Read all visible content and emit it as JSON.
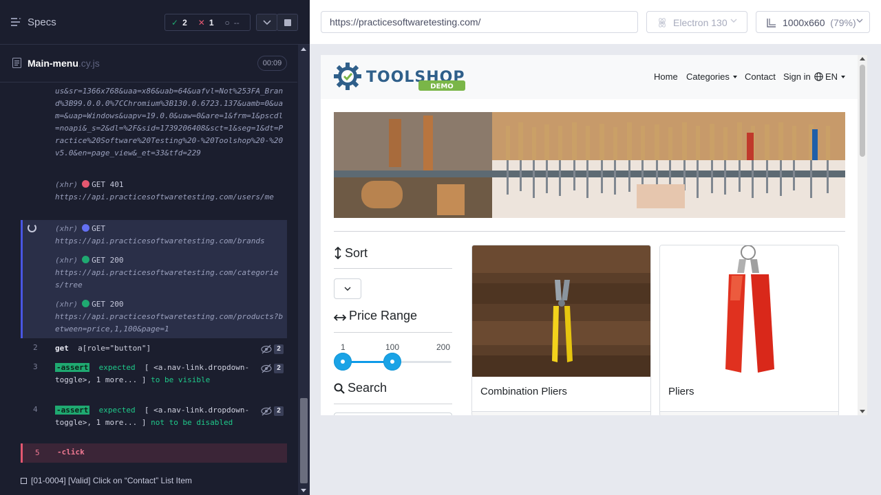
{
  "reporter": {
    "specs_label": "Specs",
    "stats": {
      "passed": "2",
      "failed": "1",
      "pending": "--"
    },
    "spec_name": "Main-menu",
    "spec_ext": ".cy.js",
    "duration": "00:09",
    "log": {
      "ga_url_tail": "us&sr=1366x768&uaa=x86&uab=64&uafvl=Not%253FA_Brand%3B99.0.0.0%7CChromium%3B130.0.6723.137&uamb=0&uam=&uap=Windows&uapv=19.0.0&uaw=0&are=1&frm=1&pscdl=noapi&_s=2&dl=%2F&sid=1739206408&sct=1&seg=1&dt=Practice%20Software%20Testing%20-%20Toolshop%20-%20v5.0&en=page_view&_et=33&tfd=229",
      "xhr_label": "(xhr)",
      "requests": [
        {
          "method": "GET 401",
          "url": "https://api.practicesoftwaretesting.com/users/me",
          "status_color": "red"
        },
        {
          "method": "GET",
          "url": "https://api.practicesoftwaretesting.com/brands",
          "status_color": "blue"
        },
        {
          "method": "GET 200",
          "url": "https://api.practicesoftwaretesting.com/categories/tree",
          "status_color": "green"
        },
        {
          "method": "GET 200",
          "url": "https://api.practicesoftwaretesting.com/products?between=price,1,100&page=1",
          "status_color": "green"
        }
      ],
      "commands": [
        {
          "num": "2",
          "name": "get",
          "arg": "a[role=\"button\"]",
          "count": "2"
        },
        {
          "num": "3",
          "name": "-assert",
          "text_a": "expected",
          "text_b": "[ <a.nav-link.dropdown-toggle>, 1 more... ]",
          "text_c": "to be",
          "text_d": "visible",
          "count": "2"
        },
        {
          "num": "4",
          "name": "-assert",
          "text_a": "expected",
          "text_b": "[ <a.nav-link.dropdown-toggle>, 1 more... ]",
          "text_c": "not to be",
          "text_d": "disabled",
          "count": "2"
        },
        {
          "num": "5",
          "name": "-click"
        }
      ]
    },
    "test_title": "[01-0004] [Valid] Click on “Contact” List Item"
  },
  "aut": {
    "url": "https://practicesoftwaretesting.com/",
    "browser": "Electron 130",
    "viewport": "1000x660",
    "zoom": "(79%)",
    "app": {
      "logo_text": "TOOLSHOP",
      "logo_badge": "DEMO",
      "nav": {
        "home": "Home",
        "categories": "Categories",
        "contact": "Contact",
        "signin": "Sign in",
        "lang": "EN"
      },
      "sidebar": {
        "sort_title": "Sort",
        "price_title": "Price Range",
        "search_title": "Search",
        "range_min": "1",
        "range_current": "100",
        "range_max": "200"
      },
      "products": [
        {
          "name": "Combination Pliers"
        },
        {
          "name": "Pliers"
        }
      ]
    }
  },
  "colors": {
    "reporter_bg": "#1b1e2e",
    "pass": "#1fa971",
    "fail": "#e45770",
    "running": "#6470f3",
    "slider": "#1aa3e6"
  }
}
